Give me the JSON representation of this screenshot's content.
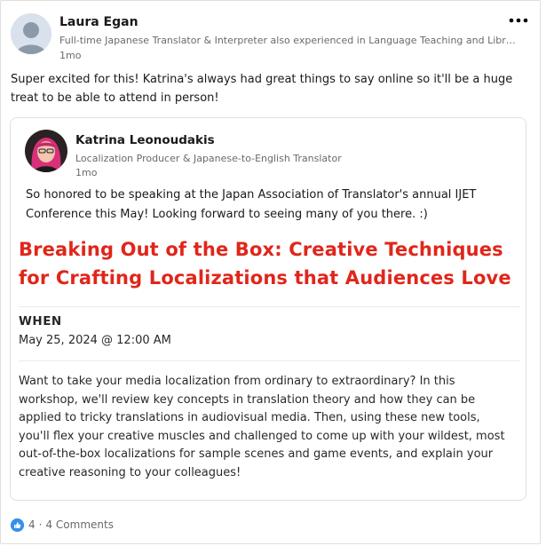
{
  "post": {
    "author": {
      "name": "Laura Egan",
      "headline": "Full-time Japanese Translator & Interpreter also experienced in Language Teaching and Library St...",
      "time": "1mo"
    },
    "more_icon": "more-horizontal-icon",
    "text": "Super excited for this! Katrina's always had great things to say online so it'll be a huge treat to be able to attend in person!",
    "shared": {
      "author": {
        "name": "Katrina Leonoudakis",
        "headline": "Localization Producer & Japanese-to-English Translator",
        "time": "1mo"
      },
      "text": "So honored to be speaking at the Japan Association of Translator's annual IJET Conference this May! Looking forward to seeing many of you there. :)",
      "event": {
        "title": "Breaking Out of the Box: Creative Techniques for Crafting Localizations that Audiences Love",
        "title_color": "#e0261b",
        "when_label": "WHEN",
        "when_value": "May 25, 2024 @ 12:00 AM",
        "description": "Want to take your media localization from ordinary to extraordinary? In this workshop, we'll review key concepts in translation theory and how they can be applied to tricky translations in audiovisual media. Then, using these new tools, you'll flex your creative muscles and challenged to come up with your wildest, most out-of-the-box localizations for sample scenes and game events, and explain your creative reasoning to your colleagues!"
      }
    },
    "social": {
      "reaction_icon": "like-icon",
      "reaction_count": "4",
      "separator": "·",
      "comments": "4 Comments"
    },
    "colors": {
      "like_blue": "#378fe9",
      "event_red": "#e0261b"
    }
  }
}
